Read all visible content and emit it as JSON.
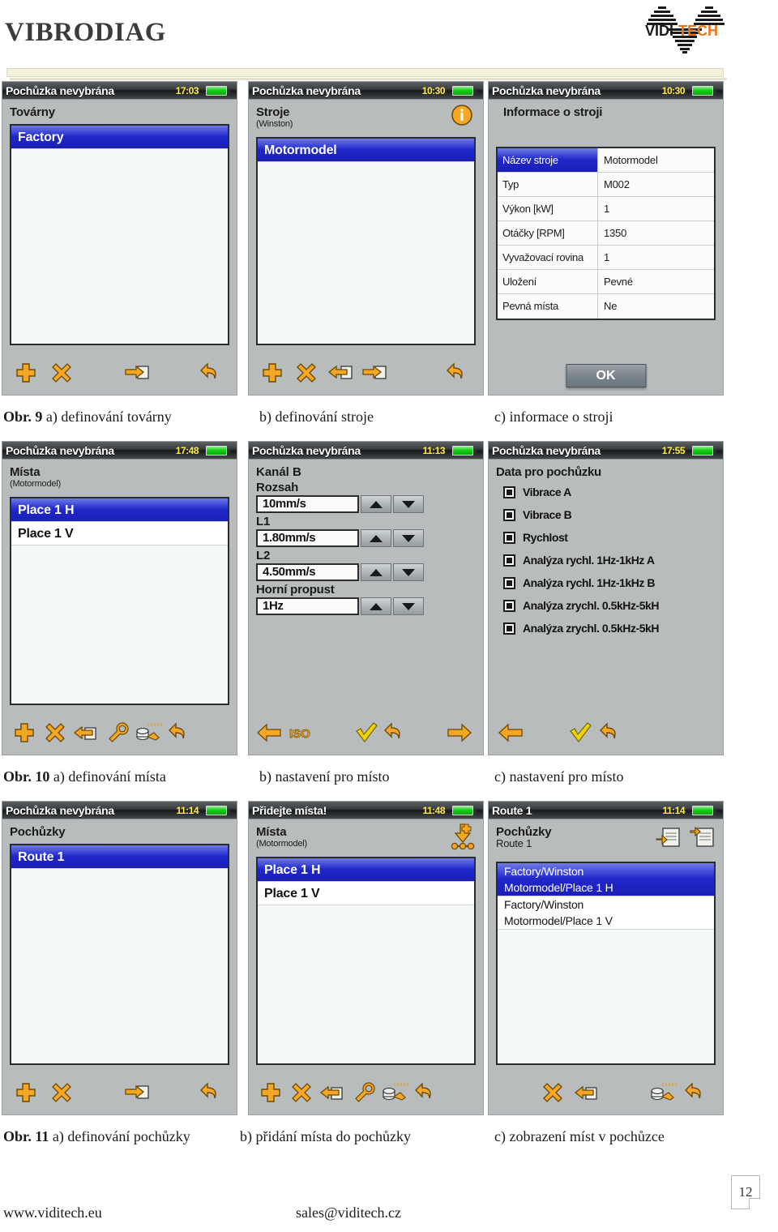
{
  "header": {
    "brand_title": "VIBRODIAG",
    "logo_text_dark": "VIDI",
    "logo_text_accent": "TECH",
    "accent_color": "#E8761A"
  },
  "figures": [
    {
      "caption_number": "Obr. 9",
      "caption_a": "a) definování továrny",
      "caption_b": "b) definování stroje",
      "caption_c": "c) informace o stroji",
      "screens": [
        {
          "titlebar": {
            "title": "Pochůzka nevybrána",
            "time": "17:03",
            "battery": "full"
          },
          "heading": "Továrny",
          "subheading": "",
          "list": [
            {
              "label": "Factory",
              "selected": true
            }
          ],
          "toolbar": [
            "plus-icon",
            "cross-icon",
            "export-right-icon",
            "back-arrow-icon"
          ]
        },
        {
          "titlebar": {
            "title": "Pochůzka nevybrána",
            "time": "10:30",
            "battery": "full"
          },
          "heading": "Stroje",
          "subheading": "(Winston)",
          "corner_icon": "info-icon",
          "list": [
            {
              "label": "Motormodel",
              "selected": true
            }
          ],
          "toolbar": [
            "plus-icon",
            "cross-icon",
            "import-left-icon",
            "export-right-icon",
            "back-arrow-icon"
          ]
        },
        {
          "titlebar": {
            "title": "Pochůzka nevybrána",
            "time": "10:30",
            "battery": "full"
          },
          "heading": "Informace o stroji",
          "table": [
            {
              "key": "Název stroje",
              "value": "Motormodel",
              "selected": true
            },
            {
              "key": "Typ",
              "value": "M002",
              "selected": false
            },
            {
              "key": "Výkon [kW]",
              "value": "1",
              "selected": false
            },
            {
              "key": "Otáčky [RPM]",
              "value": "1350",
              "selected": false
            },
            {
              "key": "Vyvažovací rovina",
              "value": "1",
              "selected": false
            },
            {
              "key": "Uložení",
              "value": "Pevné",
              "selected": false
            },
            {
              "key": "Pevná místa",
              "value": "Ne",
              "selected": false
            }
          ],
          "ok_button": "OK"
        }
      ]
    },
    {
      "caption_number": "Obr. 10",
      "caption_a": "a) definování místa",
      "caption_b": "b) nastavení pro místo",
      "caption_c": "c) nastavení pro místo",
      "screens": [
        {
          "titlebar": {
            "title": "Pochůzka nevybrána",
            "time": "17:48",
            "battery": "full"
          },
          "heading": "Místa",
          "subheading": "(Motormodel)",
          "list": [
            {
              "label": "Place 1 H",
              "selected": true
            },
            {
              "label": "Place 1 V",
              "selected": false
            }
          ],
          "toolbar": [
            "plus-icon",
            "cross-icon",
            "import-left-icon",
            "wrench-icon",
            "measure-icon",
            "back-arrow-icon"
          ]
        },
        {
          "titlebar": {
            "title": "Pochůzka nevybrána",
            "time": "11:13",
            "battery": "full"
          },
          "heading": "Kanál B",
          "fields": [
            {
              "label": "Rozsah",
              "value": "10mm/s"
            },
            {
              "label": "L1",
              "value": "1.80mm/s"
            },
            {
              "label": "L2",
              "value": "4.50mm/s"
            },
            {
              "label": "Horní propust",
              "value": "1Hz"
            }
          ],
          "toolbar": [
            "left-arrow-icon",
            "iso-icon",
            "check-icon",
            "back-arrow-icon",
            "right-arrow-icon"
          ]
        },
        {
          "titlebar": {
            "title": "Pochůzka nevybrána",
            "time": "17:55",
            "battery": "full"
          },
          "heading": "Data pro pochůzku",
          "checkboxes": [
            {
              "label": "Vibrace A",
              "checked": true
            },
            {
              "label": "Vibrace B",
              "checked": true
            },
            {
              "label": "Rychlost",
              "checked": true
            },
            {
              "label": "Analýza rychl. 1Hz-1kHz A",
              "checked": true
            },
            {
              "label": "Analýza rychl. 1Hz-1kHz B",
              "checked": true
            },
            {
              "label": "Analýza zrychl. 0.5kHz-5kH",
              "checked": true
            },
            {
              "label": "Analýza zrychl. 0.5kHz-5kH",
              "checked": true
            }
          ],
          "toolbar": [
            "left-arrow-icon",
            "check-icon",
            "back-arrow-icon"
          ]
        }
      ]
    },
    {
      "caption_number": "Obr. 11",
      "caption_a": "a) definování pochůzky",
      "caption_b": "b) přidání místa do pochůzky",
      "caption_c": "c) zobrazení míst v pochůzce",
      "screens": [
        {
          "titlebar": {
            "title": "Pochůzka nevybrána",
            "time": "11:14",
            "battery": "full"
          },
          "heading": "Pochůzky",
          "subheading": "",
          "list": [
            {
              "label": "Route 1",
              "selected": true
            }
          ],
          "toolbar": [
            "plus-icon",
            "cross-icon",
            "export-right-icon",
            "back-arrow-icon"
          ]
        },
        {
          "titlebar": {
            "title": "Přidejte místa!",
            "time": "11:48",
            "battery": "full"
          },
          "heading": "Místa",
          "subheading": "(Motormodel)",
          "corner_icon": "add-place-icon",
          "list": [
            {
              "label": "Place 1 H",
              "selected": true
            },
            {
              "label": "Place 1 V",
              "selected": false
            }
          ],
          "toolbar": [
            "plus-icon",
            "cross-icon",
            "import-left-icon",
            "wrench-icon",
            "measure-icon",
            "back-arrow-icon"
          ]
        },
        {
          "titlebar": {
            "title": "Route 1",
            "time": "11:14",
            "battery": "full"
          },
          "heading": "Pochůzky",
          "subheading": "Route 1",
          "corner_icon_a": "move-up-icon",
          "corner_icon_b": "move-down-icon",
          "pairs": [
            {
              "line1": "Factory/Winston",
              "line2": "Motormodel/Place 1 H",
              "selected": true
            },
            {
              "line1": "Factory/Winston",
              "line2": "Motormodel/Place 1 V",
              "selected": false
            }
          ],
          "toolbar": [
            "cross-icon",
            "import-left-icon",
            "measure-icon",
            "back-arrow-icon"
          ]
        }
      ]
    }
  ],
  "footer": {
    "website": "www.viditech.eu",
    "email": "sales@viditech.cz",
    "page_number": "12"
  }
}
